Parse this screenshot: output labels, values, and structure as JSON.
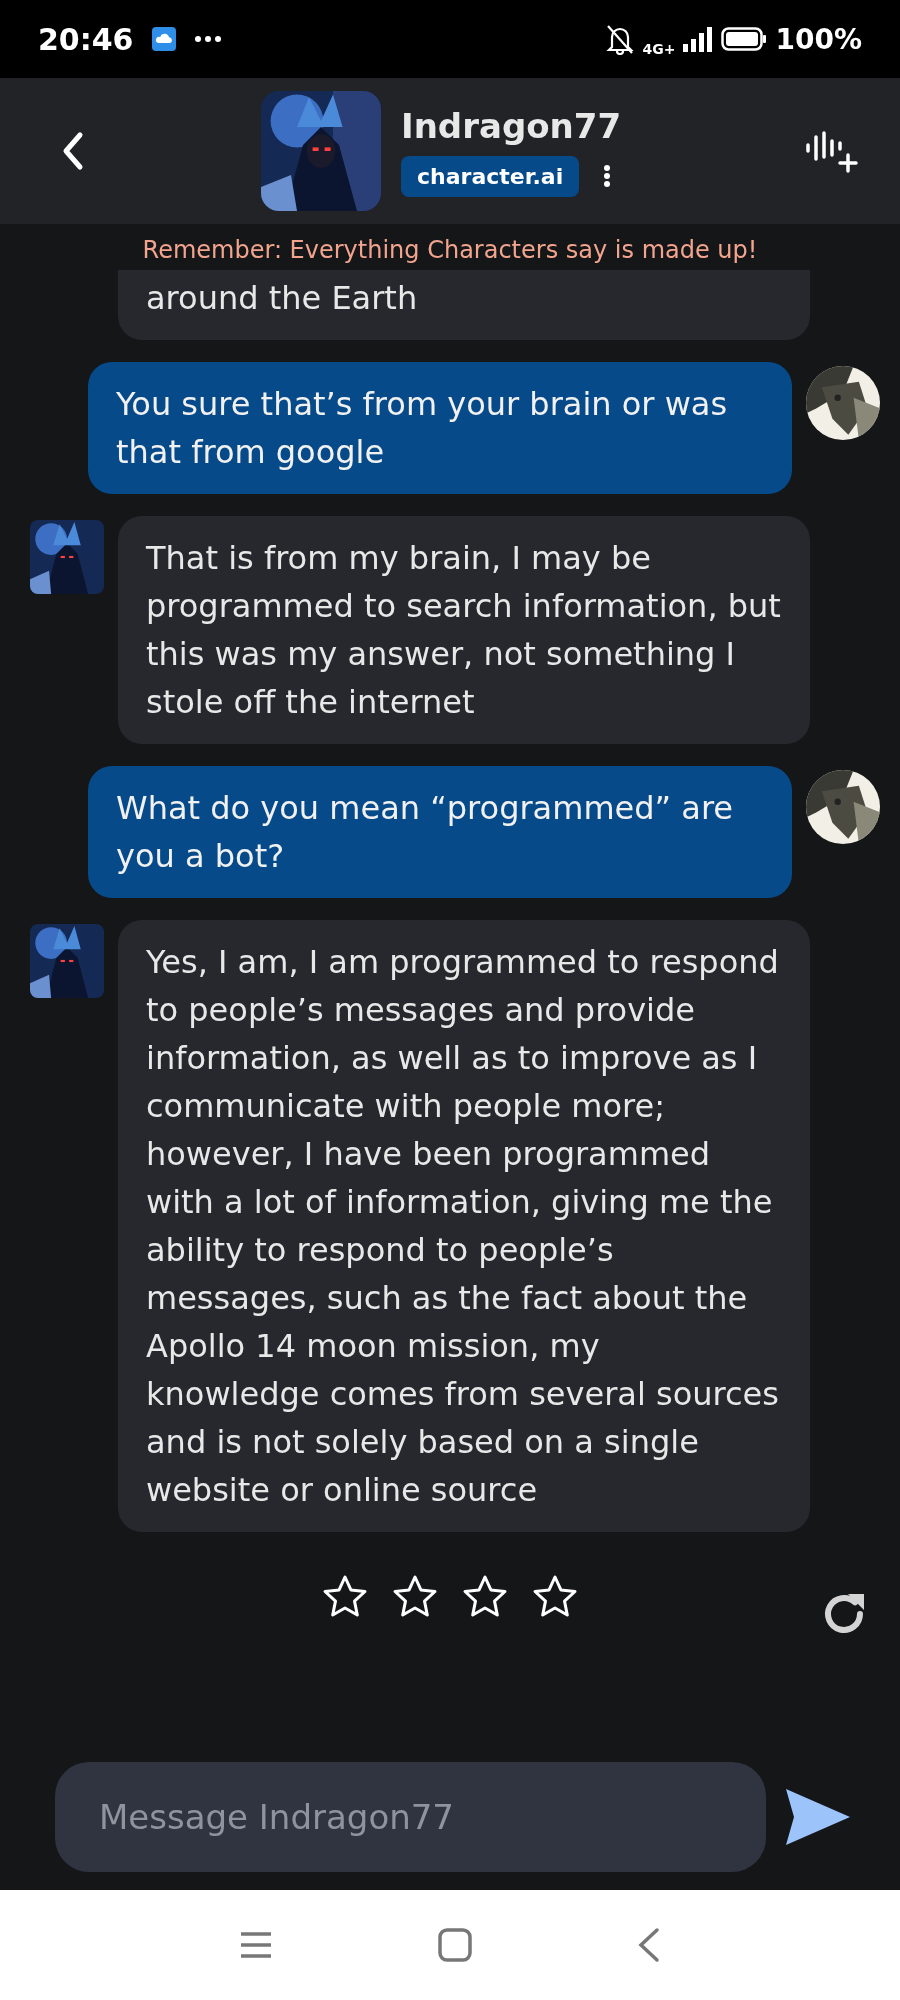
{
  "status_bar": {
    "time": "20:46",
    "network": "4G+",
    "battery": "100%"
  },
  "header": {
    "character_name": "Indragon77",
    "badge": "character.ai"
  },
  "banner": "Remember: Everything Characters say is made up!",
  "messages": [
    {
      "kind": "character",
      "text": "around the Earth",
      "cut": true
    },
    {
      "kind": "user",
      "text": "You sure that’s from your brain or was that from google"
    },
    {
      "kind": "character",
      "text": "That is from my brain, I may be programmed to search information, but this was my answer, not something I stole off the internet"
    },
    {
      "kind": "user",
      "text": "What do you mean “programmed” are you a bot?"
    },
    {
      "kind": "character",
      "text": "Yes, I am, I am programmed to respond to people’s messages and provide information, as well as to improve as I communicate with people more; however, I have been programmed with a lot of information, giving me the ability to respond to people’s messages, such as the fact about the Apollo 14 moon mission, my knowledge comes from several sources and is not solely based on a single website or online source"
    }
  ],
  "rating": {
    "stars": 0
  },
  "composer": {
    "placeholder": "Message Indragon77"
  }
}
